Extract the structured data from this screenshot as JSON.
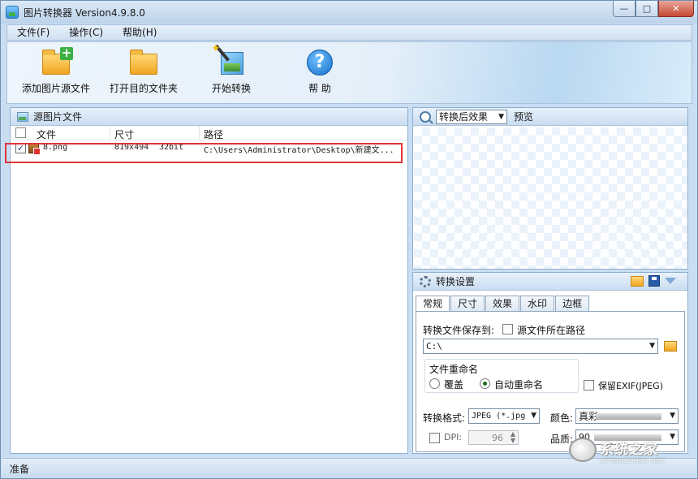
{
  "window": {
    "title": "图片转换器 Version4.9.8.0"
  },
  "menu": [
    "文件(F)",
    "操作(C)",
    "帮助(H)"
  ],
  "toolbar": {
    "add_source": "添加图片源文件",
    "open_dest": "打开目的文件夹",
    "start": "开始转换",
    "help": "帮 助"
  },
  "source_panel": {
    "title": "源图片文件",
    "columns": [
      "文件",
      "尺寸",
      "路径"
    ],
    "rows": [
      {
        "checked": true,
        "file": "8.png",
        "size": "819x494",
        "bits": "32bit",
        "path": "C:\\Users\\Administrator\\Desktop\\新建文..."
      }
    ]
  },
  "preview": {
    "mode": "转换后效果",
    "label": "预览"
  },
  "settings": {
    "title": "转换设置",
    "tabs": [
      "常规",
      "尺寸",
      "效果",
      "水印",
      "边框"
    ],
    "active_tab": "常规",
    "save_to_label": "转换文件保存到:",
    "source_path_label": "源文件所在路径",
    "source_path_checked": false,
    "save_path": "C:\\",
    "rename_group": "文件重命名",
    "rename_overwrite": "覆盖",
    "rename_auto": "自动重命名",
    "rename_selected": "自动重命名",
    "keep_exif": "保留EXIF(JPEG)",
    "keep_exif_checked": false,
    "format_label": "转换格式:",
    "format_value": "JPEG (*.jpg",
    "color_label": "颜色:",
    "color_value": "真彩",
    "dpi_label": "DPI:",
    "dpi_value": "96",
    "dpi_checked": false,
    "quality_label": "品质:",
    "quality_value": "90"
  },
  "status": {
    "text": "准备"
  },
  "watermark": {
    "text": "系统之家",
    "sub": "XITONGZHIJIA.NET"
  },
  "colors": {
    "accent": "#e0353a",
    "frame": "#c9def2"
  },
  "icons": [
    "app-icon",
    "add-folder-icon",
    "open-folder-icon",
    "magic-wand-icon",
    "help-icon",
    "image-icon",
    "zoom-icon",
    "gear-icon",
    "folder-icon",
    "save-icon",
    "collapse-icon"
  ]
}
